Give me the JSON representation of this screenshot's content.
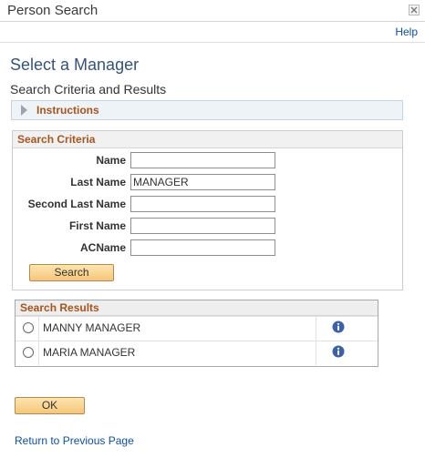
{
  "window": {
    "title": "Person Search"
  },
  "header": {
    "help_label": "Help"
  },
  "page": {
    "title": "Select a Manager",
    "subtitle": "Search Criteria and Results"
  },
  "instructions": {
    "label": "Instructions"
  },
  "search_criteria": {
    "header": "Search Criteria",
    "fields": [
      {
        "label": "Name",
        "value": ""
      },
      {
        "label": "Last Name",
        "value": "MANAGER"
      },
      {
        "label": "Second Last Name",
        "value": ""
      },
      {
        "label": "First Name",
        "value": ""
      },
      {
        "label": "ACName",
        "value": ""
      }
    ],
    "search_button": "Search"
  },
  "search_results": {
    "header": "Search Results",
    "rows": [
      {
        "name": "MANNY MANAGER",
        "selected": false
      },
      {
        "name": "MARIA MANAGER",
        "selected": false
      }
    ]
  },
  "actions": {
    "ok_label": "OK",
    "return_label": "Return to Previous Page"
  },
  "colors": {
    "accent_title": "#35537c",
    "section_header": "#a7541c",
    "link": "#0d4fa3",
    "button_fill": "#f6c67a",
    "info_icon": "#3b62a8"
  }
}
